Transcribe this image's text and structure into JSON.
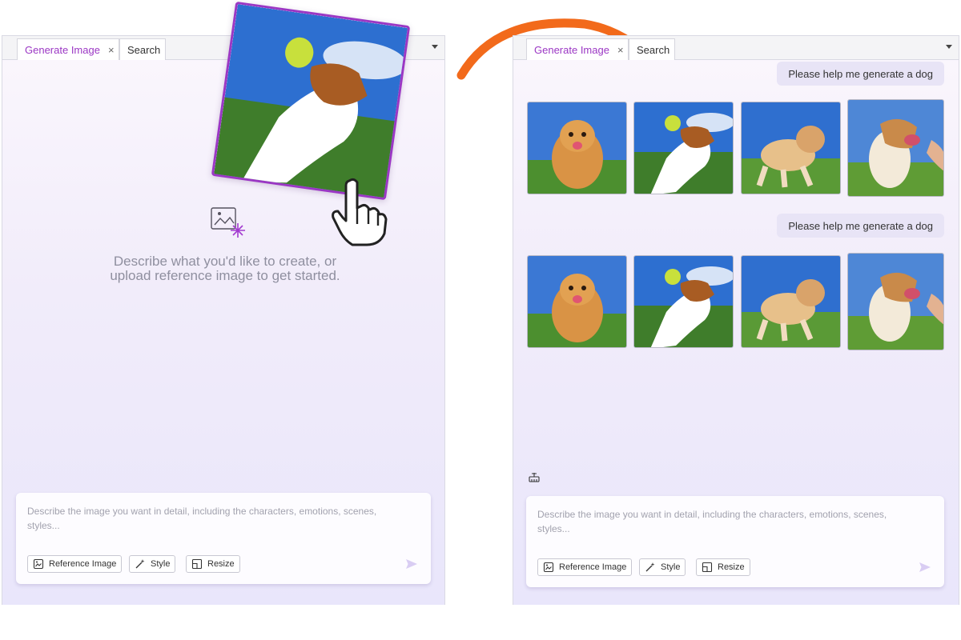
{
  "colors": {
    "accent": "#9b37c4",
    "arrow": "#f26a1b",
    "chip_bg": "#e8e4f6"
  },
  "left_panel": {
    "tabs": [
      {
        "label": "Generate Image",
        "close": "×"
      },
      {
        "label": "Search"
      }
    ],
    "empty_icon": "image-sparkle-icon",
    "empty_message": "Describe what you'd like to create, or upload reference image to get started.",
    "composer": {
      "placeholder": "Describe the image you want in detail, including the characters, emotions, scenes, styles...",
      "buttons": [
        {
          "label": "Reference Image",
          "icon": "reference-image-icon"
        },
        {
          "label": "Style",
          "icon": "magic-wand-icon"
        },
        {
          "label": "Resize",
          "icon": "resize-icon"
        }
      ],
      "send_icon": "send-icon"
    }
  },
  "right_panel": {
    "tabs": [
      {
        "label": "Generate Image",
        "close": "×"
      },
      {
        "label": "Search"
      }
    ],
    "prompts": [
      {
        "text": "Please help me generate a dog",
        "images": [
          "fluffy dog sitting on grass",
          "dog catching tennis ball",
          "fluffy dog running",
          "dog jumping to hand"
        ]
      },
      {
        "text": "Please help me generate a dog",
        "images": [
          "fluffy dog sitting on grass",
          "dog catching tennis ball",
          "fluffy dog running",
          "dog jumping to hand"
        ]
      }
    ],
    "clear_icon": "broom-icon",
    "composer": {
      "placeholder": "Describe the image you want in detail, including the characters, emotions, scenes, styles...",
      "buttons": [
        {
          "label": "Reference Image",
          "icon": "reference-image-icon"
        },
        {
          "label": "Style",
          "icon": "magic-wand-icon"
        },
        {
          "label": "Resize",
          "icon": "resize-icon"
        }
      ],
      "send_icon": "send-icon"
    }
  }
}
